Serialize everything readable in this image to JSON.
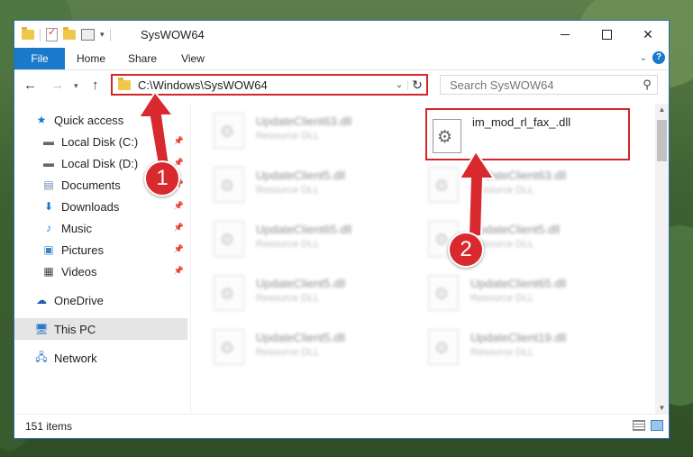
{
  "window": {
    "title": "SysWOW64",
    "ribbon_tabs": [
      "File",
      "Home",
      "Share",
      "View"
    ],
    "help_label": "?"
  },
  "address": {
    "path": "C:\\Windows\\SysWOW64",
    "search_placeholder": "Search SysWOW64"
  },
  "navpane": {
    "items": [
      {
        "label": "Quick access",
        "icon": "star-icon",
        "pinned": false
      },
      {
        "label": "Local Disk (C:)",
        "icon": "drive-icon",
        "pinned": true
      },
      {
        "label": "Local Disk (D:)",
        "icon": "drive-icon",
        "pinned": true
      },
      {
        "label": "Documents",
        "icon": "documents-icon",
        "pinned": true
      },
      {
        "label": "Downloads",
        "icon": "downloads-icon",
        "pinned": true
      },
      {
        "label": "Music",
        "icon": "music-icon",
        "pinned": true
      },
      {
        "label": "Pictures",
        "icon": "pictures-icon",
        "pinned": true
      },
      {
        "label": "Videos",
        "icon": "videos-icon",
        "pinned": true
      },
      {
        "label": "OneDrive",
        "icon": "cloud-icon",
        "pinned": false
      },
      {
        "label": "This PC",
        "icon": "computer-icon",
        "pinned": false,
        "selected": true
      },
      {
        "label": "Network",
        "icon": "network-icon",
        "pinned": false
      }
    ]
  },
  "files": {
    "highlighted": {
      "name": "im_mod_rl_fax_.dll"
    },
    "left_column": [
      {
        "name": "UpdateClient63.dll",
        "type": "Resource DLL"
      },
      {
        "name": "UpdateClient5.dll",
        "type": "Resource DLL"
      },
      {
        "name": "UpdateClient65.dll",
        "type": "Resource DLL"
      },
      {
        "name": "UpdateClient5.dll",
        "type": "Resource DLL"
      },
      {
        "name": "UpdateClient5.dll",
        "type": "Resource DLL"
      }
    ],
    "right_column": [
      {
        "name": "UpdateClient63.dll",
        "type": "Resource DLL"
      },
      {
        "name": "UpdateClient5.dll",
        "type": "Resource DLL"
      },
      {
        "name": "UpdateClient65.dll",
        "type": "Resource DLL"
      },
      {
        "name": "UpdateClient19.dll",
        "type": "Resource DLL"
      }
    ]
  },
  "status": {
    "item_count": "151 items"
  },
  "callouts": {
    "step1": "1",
    "step2": "2"
  },
  "colors": {
    "accent": "#1979ca",
    "highlight": "#d2262b"
  }
}
